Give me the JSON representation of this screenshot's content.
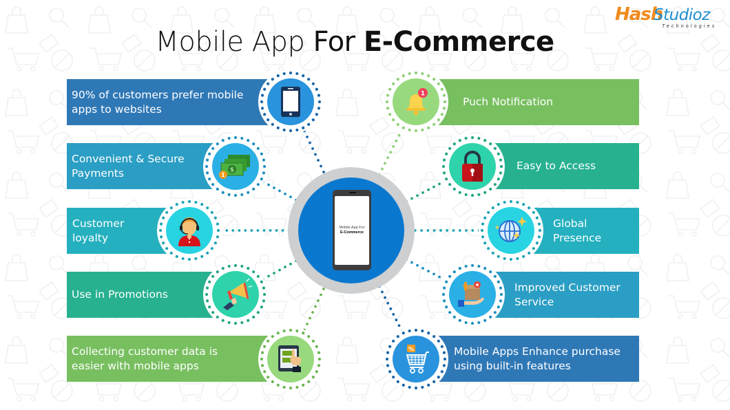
{
  "title": {
    "light": "Mobile App",
    "regular": "For",
    "bold": "E-Commerce"
  },
  "logo": {
    "brand_part1": "Hash",
    "brand_part2": "Studioz",
    "tagline": "Technologies",
    "primary_color": "#f08a1c",
    "secondary_color": "#1c8fd0"
  },
  "center": {
    "line1": "Mobile App For",
    "line2": "E-Commerce",
    "ring_color": "#cdcfd1",
    "fill_color": "#0b78cf"
  },
  "left_items": [
    {
      "text": "90% of customers prefer mobile apps to websites",
      "icon": "smartphone-icon",
      "color": "#2f78b6",
      "icon_bg": "#2a93dd",
      "dot_color": "#1765a7"
    },
    {
      "text": "Convenient & Secure Payments",
      "icon": "cash-payment-icon",
      "color": "#2a9ec4",
      "icon_bg": "#2bb0e6",
      "dot_color": "#1f8fbf"
    },
    {
      "text": "Customer loyalty",
      "icon": "customer-support-icon",
      "color": "#25b0bf",
      "icon_bg": "#28d3e2",
      "dot_color": "#1ea5b3"
    },
    {
      "text": "Use in Promotions",
      "icon": "megaphone-icon",
      "color": "#27b18f",
      "icon_bg": "#2fd3ab",
      "dot_color": "#21a584"
    },
    {
      "text": "Collecting customer data is easier with mobile apps",
      "icon": "tablet-form-icon",
      "color": "#78bf60",
      "icon_bg": "#98d97e",
      "dot_color": "#6cb553"
    }
  ],
  "right_items": [
    {
      "text": "Puch Notification",
      "icon": "notification-bell-icon",
      "color": "#78bf60",
      "icon_bg": "#98d97e",
      "dot_color": "#8fcf77",
      "badge_count": "1"
    },
    {
      "text": "Easy to Access",
      "icon": "padlock-icon",
      "color": "#27b18f",
      "icon_bg": "#2fd3ab",
      "dot_color": "#21a584"
    },
    {
      "text": "Global Presence",
      "icon": "globe-icon",
      "color": "#25b0bf",
      "icon_bg": "#28d3e2",
      "dot_color": "#1ea5b3"
    },
    {
      "text": "Improved Customer Service",
      "icon": "service-box-icon",
      "color": "#2a9ec4",
      "icon_bg": "#2bb0e6",
      "dot_color": "#1f8fbf"
    },
    {
      "text": "Mobile Apps Enhance purchase using built-in features",
      "icon": "shopping-cart-icon",
      "color": "#2f78b6",
      "icon_bg": "#2a93dd",
      "dot_color": "#1765a7",
      "tag": "%"
    }
  ]
}
